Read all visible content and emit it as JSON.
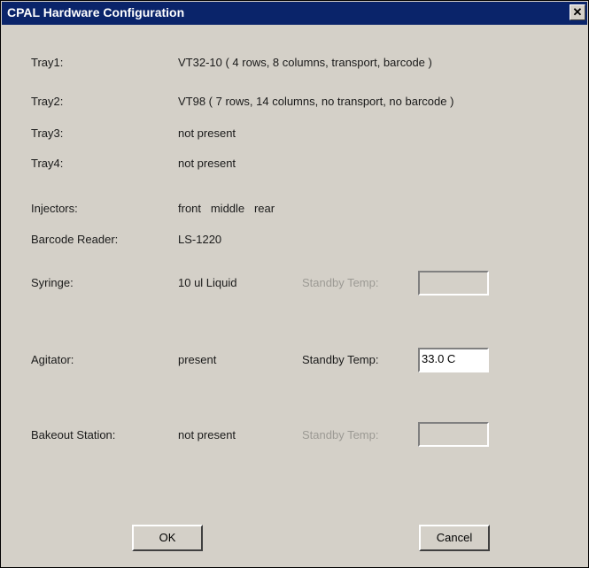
{
  "window": {
    "title": "CPAL Hardware Configuration",
    "close_glyph": "✕"
  },
  "config": {
    "tray1": {
      "label": "Tray1:",
      "value": "VT32-10  ( 4 rows, 8 columns, transport, barcode  )"
    },
    "tray2": {
      "label": "Tray2:",
      "value": "VT98  ( 7 rows, 14 columns, no transport, no barcode  )"
    },
    "tray3": {
      "label": "Tray3:",
      "value": "not present"
    },
    "tray4": {
      "label": "Tray4:",
      "value": "not present"
    },
    "injectors": {
      "label": "Injectors:",
      "value": "front   middle   rear"
    },
    "barcode_reader": {
      "label": "Barcode Reader:",
      "value": "LS-1220"
    },
    "syringe": {
      "label": "Syringe:",
      "value": "10 ul Liquid",
      "standby_label": "Standby Temp:",
      "standby_value": ""
    },
    "agitator": {
      "label": "Agitator:",
      "value": "present",
      "standby_label": "Standby Temp:",
      "standby_value": "33.0 C"
    },
    "bakeout": {
      "label": "Bakeout Station:",
      "value": "not present",
      "standby_label": "Standby Temp:",
      "standby_value": ""
    }
  },
  "buttons": {
    "ok": "OK",
    "cancel": "Cancel"
  }
}
